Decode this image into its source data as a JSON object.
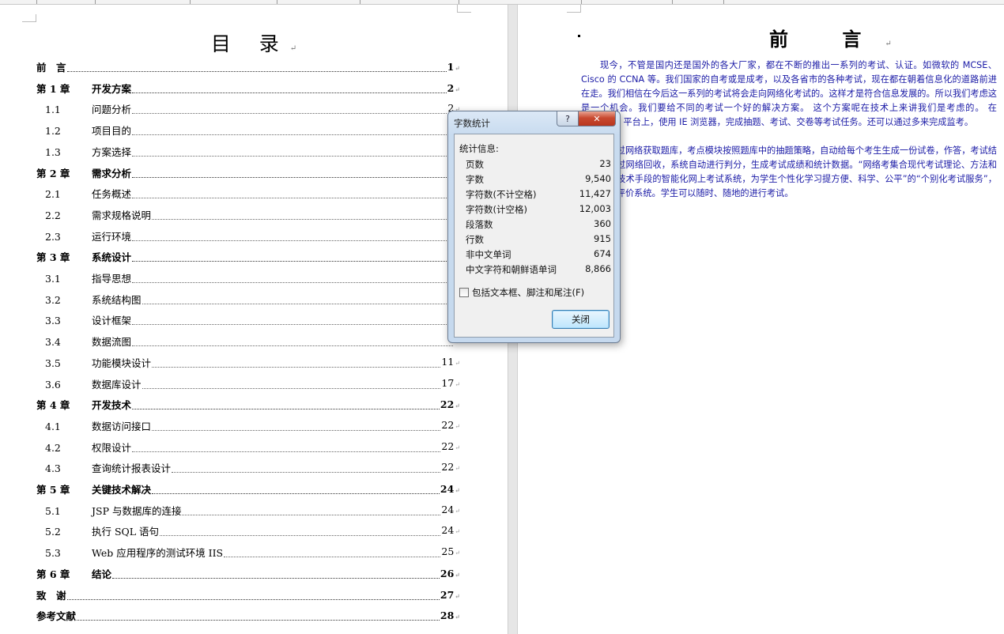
{
  "toc": {
    "title": "目 录",
    "entries": [
      {
        "num": "前　言",
        "text": "",
        "page": "1",
        "level": "chapter"
      },
      {
        "num": "第 1 章",
        "text": "开发方案",
        "page": "2",
        "level": "chapter"
      },
      {
        "num": "1.1",
        "text": "问题分析",
        "page": "2",
        "level": "sub"
      },
      {
        "num": "1.2",
        "text": "项目目的",
        "page": "",
        "level": "sub"
      },
      {
        "num": "1.3",
        "text": "方案选择",
        "page": "",
        "level": "sub"
      },
      {
        "num": "第 2 章",
        "text": "需求分析",
        "page": "",
        "level": "chapter"
      },
      {
        "num": "2.1",
        "text": "任务概述",
        "page": "",
        "level": "sub"
      },
      {
        "num": "2.2",
        "text": "需求规格说明",
        "page": "",
        "level": "sub"
      },
      {
        "num": "2.3",
        "text": "运行环境",
        "page": "",
        "level": "sub"
      },
      {
        "num": "第 3 章",
        "text": "系统设计",
        "page": "",
        "level": "chapter"
      },
      {
        "num": "3.1",
        "text": "指导思想",
        "page": "",
        "level": "sub"
      },
      {
        "num": "3.2",
        "text": "系统结构图",
        "page": "",
        "level": "sub"
      },
      {
        "num": "3.3",
        "text": "设计框架",
        "page": "",
        "level": "sub"
      },
      {
        "num": "3.4",
        "text": "数据流图",
        "page": "",
        "level": "sub"
      },
      {
        "num": "3.5",
        "text": "功能模块设计",
        "page": "11",
        "level": "sub"
      },
      {
        "num": "3.6",
        "text": "数据库设计",
        "page": "17",
        "level": "sub"
      },
      {
        "num": "第 4 章",
        "text": "开发技术",
        "page": "22",
        "level": "chapter"
      },
      {
        "num": "4.1",
        "text": "数据访问接口",
        "page": "22",
        "level": "sub"
      },
      {
        "num": "4.2",
        "text": "权限设计",
        "page": "22",
        "level": "sub"
      },
      {
        "num": "4.3",
        "text": "查询统计报表设计",
        "page": "22",
        "level": "sub"
      },
      {
        "num": "第 5 章",
        "text": "关键技术解决",
        "page": "24",
        "level": "chapter"
      },
      {
        "num": "5.1",
        "text": "JSP 与数据库的连接",
        "page": "24",
        "level": "sub"
      },
      {
        "num": "5.2",
        "text": "执行 SQL 语句",
        "page": "24",
        "level": "sub"
      },
      {
        "num": "5.3",
        "text": "Web 应用程序的测试环境 IIS",
        "page": "25",
        "level": "sub"
      },
      {
        "num": "第 6 章",
        "text": "结论",
        "page": "26",
        "level": "chapter"
      },
      {
        "num": "致　谢",
        "text": "",
        "page": "27",
        "level": "chapter"
      },
      {
        "num": "参考文献",
        "text": "",
        "page": "28",
        "level": "chapter"
      }
    ]
  },
  "preface": {
    "title": "前 言",
    "p1": "现今，不管是国内还是国外的各大厂家，都在不断的推出一系列的考试、认证。如微软的 MCSE、Cisco 的 CCNA 等。我们国家的自考或是成考，以及各省市的各种考试，现在都在朝着信息化的道路前进在走。我们相信在今后这一系列的考试将会走向网络化考试的。这样才是符合信息发展的。所以我们考虑这是一个机会。我们要给不同的考试一个好的解决方案。 这个方案呢在技术上来讲我们是考虑的。 在 Windows 平台上，使用 IE 浏览器，完成抽题、考试、交卷等考试任务。还可以通过多来完成监考。",
    "p2": "点模块通过网络获取题库，考点模块按照题库中的抽题策略，自动给每个考生生成一份试卷，作答，考试结果数据通过网络回收，系统自动进行判分，生成考试成绩和统计数据。“网络考集合现代考试理论、方法和现代信息技术手段的智能化网上考试系统，为学生个性化学习提方便、科学、公平”的“个别化考试服务”，是终结性评价系统。学生可以随时、随地的进行考试。"
  },
  "dialog": {
    "title": "字数统计",
    "help_label": "?",
    "close_x": "✕",
    "group_label": "统计信息:",
    "stats": [
      {
        "label": "页数",
        "value": "23"
      },
      {
        "label": "字数",
        "value": "9,540"
      },
      {
        "label": "字符数(不计空格)",
        "value": "11,427"
      },
      {
        "label": "字符数(计空格)",
        "value": "12,003"
      },
      {
        "label": "段落数",
        "value": "360"
      },
      {
        "label": "行数",
        "value": "915"
      },
      {
        "label": "非中文单词",
        "value": "674"
      },
      {
        "label": "中文字符和朝鲜语单词",
        "value": "8,866"
      }
    ],
    "checkbox_label": "包括文本框、脚注和尾注(F)",
    "checkbox_checked": false,
    "close_button": "关闭"
  }
}
